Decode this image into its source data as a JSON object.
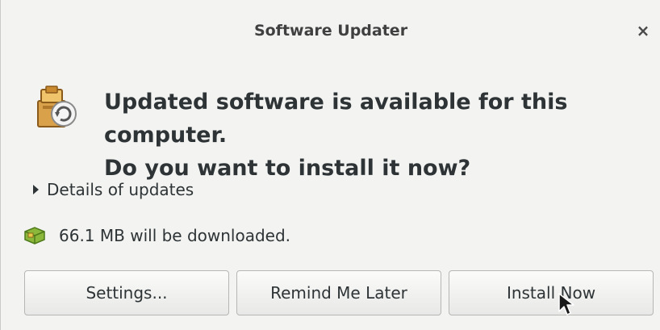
{
  "window": {
    "title": "Software Updater",
    "close_label": "×"
  },
  "main": {
    "headline_line1": "Updated software is available for this computer.",
    "headline_line2": "Do you want to install it now?"
  },
  "details": {
    "label": "Details of updates",
    "expanded": false
  },
  "download": {
    "text": "66.1 MB will be downloaded."
  },
  "buttons": {
    "settings": "Settings...",
    "remind": "Remind Me Later",
    "install": "Install Now"
  },
  "icons": {
    "app": "software-updater-icon",
    "package": "package-icon",
    "expander": "triangle-right-icon",
    "cursor": "mouse-pointer-icon"
  }
}
